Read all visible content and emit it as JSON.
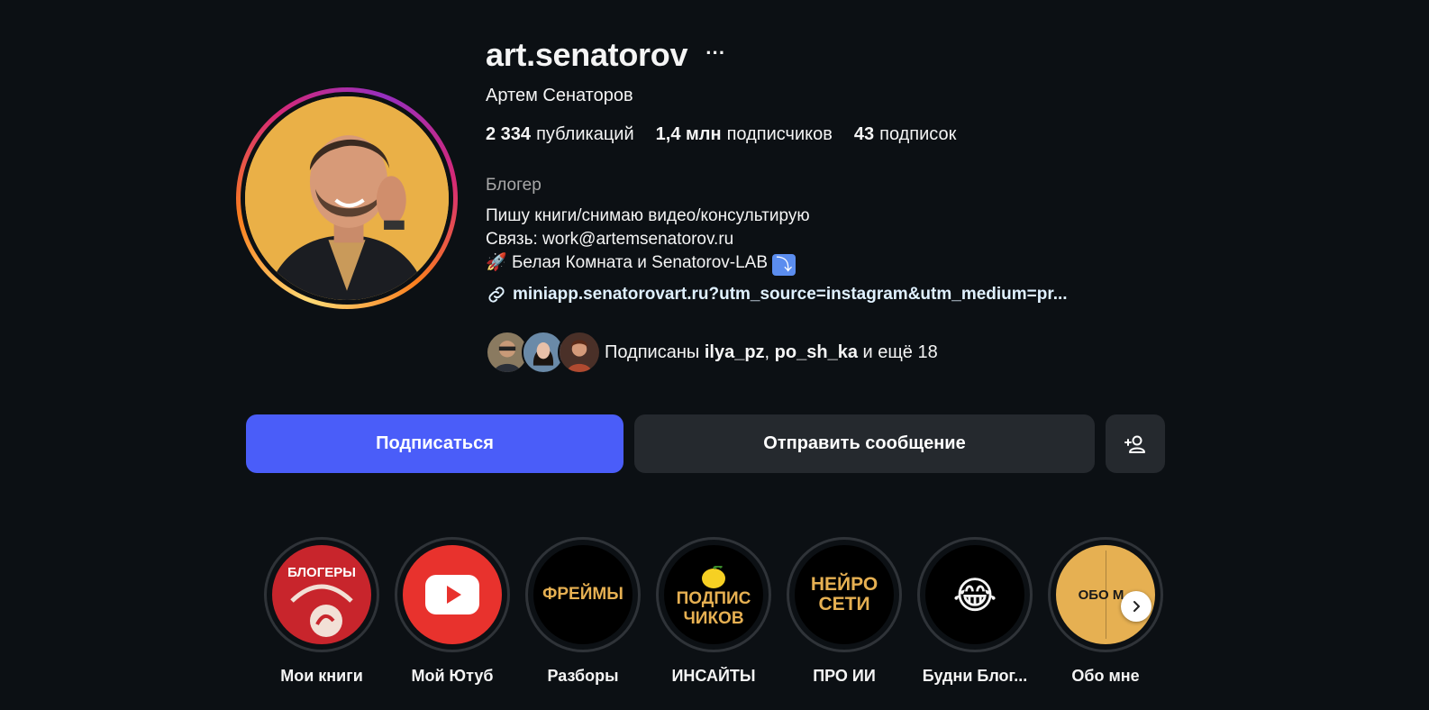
{
  "colors": {
    "background": "#0c1014",
    "follow_button": "#4a5df9",
    "secondary_button": "#25292e",
    "muted_text": "#a8a8a8",
    "highlight_gold": "#e6b052"
  },
  "profile": {
    "username": "art.senatorov",
    "more_icon": "ellipsis-icon",
    "full_name": "Артем Сенаторов",
    "avatar_icon": "profile-photo"
  },
  "stats": [
    {
      "value": "2 334",
      "label": "публикаций"
    },
    {
      "value": "1,4 млн",
      "label": "подписчиков"
    },
    {
      "value": "43",
      "label": "подписок"
    }
  ],
  "bio": {
    "category": "Блогер",
    "line1": "Пишу книги/снимаю видео/консультирую",
    "line2": "Связь: work@artemsenatorov.ru",
    "line3_emoji": "🚀",
    "line3_text": "Белая Комната и Senatorov-LAB",
    "line3_end_emoji": "⤵"
  },
  "link": {
    "icon": "link-icon",
    "text": "miniapp.senatorovart.ru?utm_source=instagram&utm_medium=pr..."
  },
  "followed_by": {
    "prefix": "Подписаны",
    "user1": "ilya_pz",
    "separator": ",",
    "user2": "po_sh_ka",
    "suffix": "и ещё 18"
  },
  "buttons": {
    "follow": "Подписаться",
    "message": "Отправить сообщение",
    "suggest_icon": "add-person-icon"
  },
  "highlights": [
    {
      "label": "Мои книги",
      "cover_text": "БЛОГЕРЫ"
    },
    {
      "label": "Мой Ютуб",
      "cover_icon": "youtube-icon"
    },
    {
      "label": "Разборы",
      "cover_text": "ФРЕЙМЫ"
    },
    {
      "label": "ИНСАЙТЫ",
      "cover_text_line1": "ПОДПИС",
      "cover_text_line2": "ЧИКОВ",
      "cover_icon": "lemon-icon"
    },
    {
      "label": "ПРО ИИ",
      "cover_text_line1": "НЕЙРО",
      "cover_text_line2": "СЕТИ"
    },
    {
      "label": "Будни Блог...",
      "cover_emoji": "😂"
    },
    {
      "label": "Обо мне",
      "cover_text": "ОБО М"
    }
  ],
  "next_icon": "chevron-right-icon"
}
